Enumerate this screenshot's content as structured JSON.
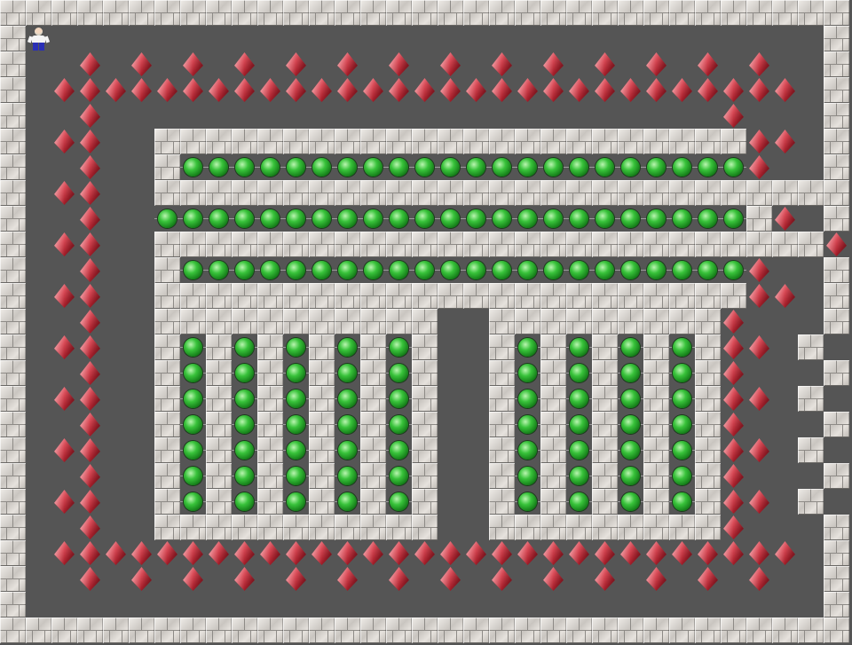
{
  "board": {
    "cols": 33,
    "rows": 25,
    "legend": {
      "#": "wall",
      " ": "floor",
      ".": "goal",
      "$": "box",
      "@": "player"
    },
    "map": [
      "#################################",
      "#@                              #",
      "#  $ $ $ $ $ $ $ $ $ $ $ $ $ $  #",
      "# $$$$$$$$$$$$$$$$$$$$$$$$$$$$$ #",
      "#  $                        $   #",
      "# $$  #######################$$ #",
      "#  $  #......................$  #",
      "# $$  ###########################$",
      "#  $  .......................#$ #",
      "# $$  ##########################$",
      "#  $  #......................$  #",
      "# $$  #######################$$ #",
      "#  $  ###########  #########$   #",
      "# $$  #.#.#.#.#.#  #.#.#.#.#$$ #",
      "#  $  #.#.#.#.#.#  #.#.#.#.#$   #",
      "# $$  #.#.#.#.#.#  #.#.#.#.#$$ #",
      "#  $  #.#.#.#.#.#  #.#.#.#.#$   #",
      "# $$  #.#.#.#.#.#  #.#.#.#.#$$ #",
      "#  $  #.#.#.#.#.#  #.#.#.#.#$   #",
      "# $$  #.#.#.#.#.#  #.#.#.#.#$$ #",
      "#  $  ###########  #########$   #",
      "# $$$$$$$$$$$$$$$$$$$$$$$$$$$$$ #",
      "#  $ $ $ $ $ $ $ $ $ $ $ $ $ $  #",
      "#                               #",
      "#################################"
    ]
  }
}
